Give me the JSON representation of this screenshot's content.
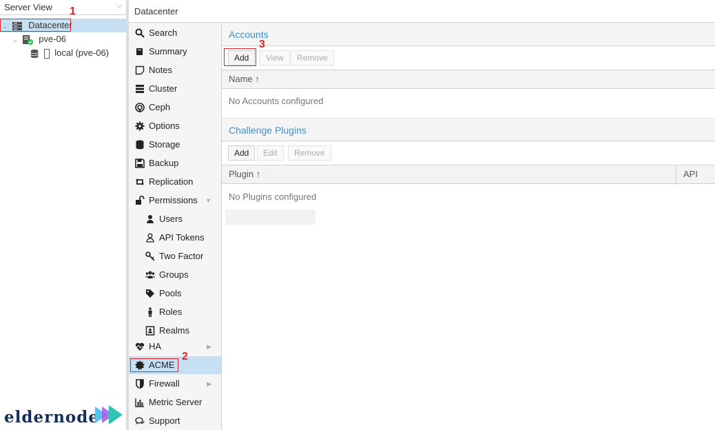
{
  "tree": {
    "view_select": "Server View",
    "datacenter": "Datacenter",
    "node": "pve-06",
    "storage": "local (pve-06)"
  },
  "header": {
    "title": "Datacenter"
  },
  "nav": {
    "items": [
      {
        "label": "Search",
        "icon": "search-icon"
      },
      {
        "label": "Summary",
        "icon": "book-icon"
      },
      {
        "label": "Notes",
        "icon": "sticky-note-icon"
      },
      {
        "label": "Cluster",
        "icon": "server-icon"
      },
      {
        "label": "Ceph",
        "icon": "ceph-icon"
      },
      {
        "label": "Options",
        "icon": "gear-icon"
      },
      {
        "label": "Storage",
        "icon": "database-icon"
      },
      {
        "label": "Backup",
        "icon": "floppy-icon"
      },
      {
        "label": "Replication",
        "icon": "retweet-icon"
      },
      {
        "label": "Permissions",
        "icon": "unlock-icon"
      },
      {
        "label": "Users",
        "icon": "user-icon"
      },
      {
        "label": "API Tokens",
        "icon": "user-outline-icon"
      },
      {
        "label": "Two Factor",
        "icon": "key-icon"
      },
      {
        "label": "Groups",
        "icon": "users-icon"
      },
      {
        "label": "Pools",
        "icon": "tags-icon"
      },
      {
        "label": "Roles",
        "icon": "male-icon"
      },
      {
        "label": "Realms",
        "icon": "address-book-icon"
      },
      {
        "label": "HA",
        "icon": "heartbeat-icon"
      },
      {
        "label": "ACME",
        "icon": "certificate-icon"
      },
      {
        "label": "Firewall",
        "icon": "shield-icon"
      },
      {
        "label": "Metric Server",
        "icon": "bar-chart-icon"
      },
      {
        "label": "Support",
        "icon": "comments-icon"
      }
    ],
    "active": "ACME"
  },
  "accounts": {
    "title": "Accounts",
    "add_label": "Add",
    "view_label": "View",
    "remove_label": "Remove",
    "col_name": "Name ↑",
    "empty_text": "No Accounts configured"
  },
  "plugins": {
    "title": "Challenge Plugins",
    "add_label": "Add",
    "edit_label": "Edit",
    "remove_label": "Remove",
    "col_plugin": "Plugin ↑",
    "col_api": "API",
    "empty_text": "No Plugins configured"
  },
  "annotations": {
    "m1": "1",
    "m2": "2",
    "m3": "3"
  },
  "logo": {
    "text": "eldernode"
  },
  "colors": {
    "accent": "#3892d4",
    "selection": "#c7dff3",
    "highlight": "#e0242b",
    "logo": "#132e5a"
  }
}
